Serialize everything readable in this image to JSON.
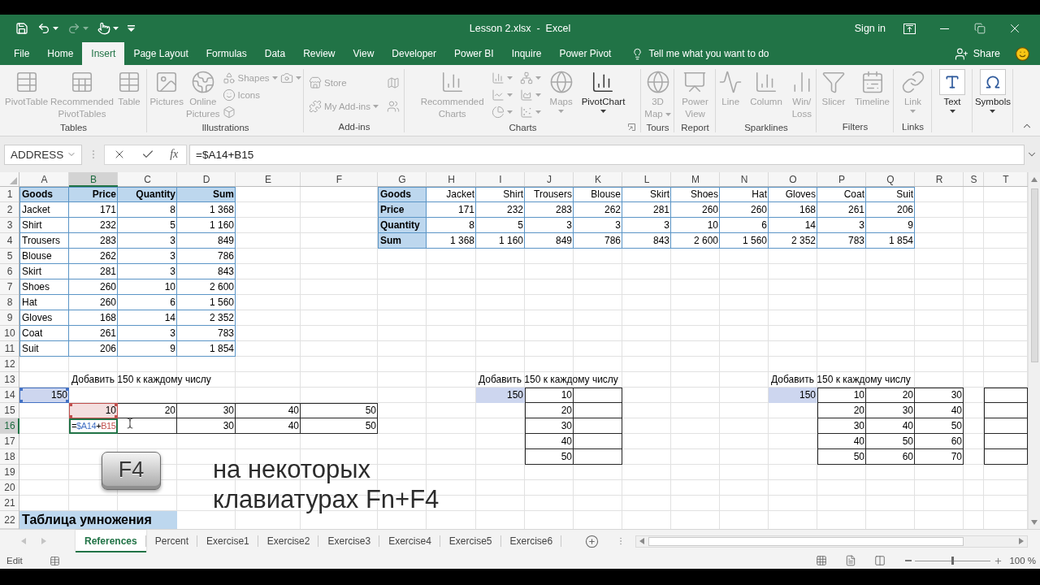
{
  "window": {
    "title": "Lesson 2.xlsx  -  Excel",
    "sign_in": "Sign in"
  },
  "quick_access": [
    {
      "disabled": false
    },
    {
      "disabled": false
    },
    {
      "disabled": true
    },
    {
      "disabled": false
    },
    {
      "disabled": false
    }
  ],
  "ribbon_tabs": [
    {
      "label": "File",
      "selected": false
    },
    {
      "label": "Home",
      "selected": false
    },
    {
      "label": "Insert",
      "selected": true
    },
    {
      "label": "Page Layout",
      "selected": false
    },
    {
      "label": "Formulas",
      "selected": false
    },
    {
      "label": "Data",
      "selected": false
    },
    {
      "label": "Review",
      "selected": false
    },
    {
      "label": "View",
      "selected": false
    },
    {
      "label": "Developer",
      "selected": false
    },
    {
      "label": "Power BI",
      "selected": false
    },
    {
      "label": "Inquire",
      "selected": false
    },
    {
      "label": "Power Pivot",
      "selected": false
    }
  ],
  "tell_me": {
    "placeholder": "Tell me what you want to do"
  },
  "share": "Share",
  "ribbon": {
    "groups": [
      {
        "label": "Tables",
        "items": [
          {
            "kind": "large",
            "label": "PivotTable",
            "disabled": true
          },
          {
            "kind": "large",
            "label": "Recommended\nPivotTables",
            "disabled": true
          },
          {
            "kind": "large",
            "label": "Table",
            "disabled": true
          }
        ]
      },
      {
        "label": "Illustrations",
        "items": [
          {
            "kind": "large",
            "label": "Pictures",
            "disabled": true
          },
          {
            "kind": "large",
            "label": "Online\nPictures",
            "disabled": true
          },
          {
            "kind": "small",
            "label": "Shapes",
            "disabled": true
          },
          {
            "kind": "small",
            "label": "Icons",
            "disabled": true
          },
          {
            "kind": "icon",
            "disabled": true
          },
          {
            "kind": "icon",
            "disabled": true
          }
        ]
      },
      {
        "label": "Add-ins",
        "items": [
          {
            "kind": "small",
            "label": "Store",
            "disabled": true
          },
          {
            "kind": "small",
            "label": "My Add-ins",
            "disabled": true
          },
          {
            "kind": "icon",
            "disabled": true
          },
          {
            "kind": "icon",
            "disabled": true
          }
        ]
      },
      {
        "label": "Charts",
        "items": [
          {
            "kind": "large",
            "label": "Recommended\nCharts",
            "disabled": true
          },
          {
            "kind": "icon",
            "disabled": true
          },
          {
            "kind": "icon",
            "disabled": true
          },
          {
            "kind": "icon",
            "disabled": true
          },
          {
            "kind": "icon",
            "disabled": true
          },
          {
            "kind": "icon",
            "disabled": true
          },
          {
            "kind": "icon",
            "disabled": true
          },
          {
            "kind": "large",
            "label": "Maps",
            "disabled": true
          },
          {
            "kind": "large",
            "label": "PivotChart",
            "disabled": false
          }
        ]
      },
      {
        "label": "Tours",
        "items": [
          {
            "kind": "large",
            "label": "3D\nMap",
            "disabled": true
          }
        ]
      },
      {
        "label": "Report",
        "items": [
          {
            "kind": "large",
            "label": "Power\nView",
            "disabled": true
          }
        ]
      },
      {
        "label": "Sparklines",
        "items": [
          {
            "kind": "large",
            "label": "Line",
            "disabled": true
          },
          {
            "kind": "large",
            "label": "Column",
            "disabled": true
          },
          {
            "kind": "large",
            "label": "Win/\nLoss",
            "disabled": true
          }
        ]
      },
      {
        "label": "Filters",
        "items": [
          {
            "kind": "large",
            "label": "Slicer",
            "disabled": true
          },
          {
            "kind": "large",
            "label": "Timeline",
            "disabled": true
          }
        ]
      },
      {
        "label": "Links",
        "items": [
          {
            "kind": "large",
            "label": "Link",
            "disabled": true
          }
        ]
      },
      {
        "items": [
          {
            "kind": "large",
            "label": "Text",
            "disabled": false
          }
        ]
      },
      {
        "items": [
          {
            "kind": "large",
            "label": "Symbols",
            "disabled": false
          }
        ]
      }
    ]
  },
  "formula_bar": {
    "name_box": "ADDRESS",
    "function_symbol": "fx",
    "formula": "=$A14+B15"
  },
  "sheet": {
    "columns": [
      "A",
      "B",
      "C",
      "D",
      "E",
      "F",
      "G",
      "H",
      "I",
      "J",
      "K",
      "L",
      "M",
      "N",
      "O",
      "P",
      "Q",
      "R",
      "S",
      "T"
    ],
    "rows": [
      {
        "number": "1",
        "cells": [
          {
            "text": "Goods",
            "kind": "key"
          },
          {
            "text": "Price",
            "kind": "heading"
          },
          {
            "text": "Quantity",
            "kind": "heading"
          },
          {
            "text": "Sum",
            "kind": "heading"
          },
          null,
          null,
          {
            "text": "Goods",
            "kind": "key"
          },
          {
            "text": "Jacket",
            "kind": "entry"
          },
          {
            "text": "Shirt",
            "kind": "entry"
          },
          {
            "text": "Trousers",
            "kind": "entry"
          },
          {
            "text": "Blouse",
            "kind": "entry"
          },
          {
            "text": "Skirt",
            "kind": "entry"
          },
          {
            "text": "Shoes",
            "kind": "entry"
          },
          {
            "text": "Hat",
            "kind": "entry"
          },
          {
            "text": "Gloves",
            "kind": "entry"
          },
          {
            "text": "Coat",
            "kind": "entry"
          },
          {
            "text": "Suit",
            "kind": "entry"
          }
        ]
      },
      {
        "number": "2",
        "cells": [
          {
            "text": "Jacket",
            "kind": "label"
          },
          {
            "text": "171",
            "kind": "entry"
          },
          {
            "text": "8",
            "kind": "entry"
          },
          {
            "text": "1 368",
            "kind": "entry"
          },
          null,
          null,
          {
            "text": "Price",
            "kind": "key"
          },
          {
            "text": "171",
            "kind": "entry"
          },
          {
            "text": "232",
            "kind": "entry"
          },
          {
            "text": "283",
            "kind": "entry"
          },
          {
            "text": "262",
            "kind": "entry"
          },
          {
            "text": "281",
            "kind": "entry"
          },
          {
            "text": "260",
            "kind": "entry"
          },
          {
            "text": "260",
            "kind": "entry"
          },
          {
            "text": "168",
            "kind": "entry"
          },
          {
            "text": "261",
            "kind": "entry"
          },
          {
            "text": "206",
            "kind": "entry"
          }
        ]
      },
      {
        "number": "3",
        "cells": [
          {
            "text": "Shirt",
            "kind": "label"
          },
          {
            "text": "232",
            "kind": "entry"
          },
          {
            "text": "5",
            "kind": "entry"
          },
          {
            "text": "1 160",
            "kind": "entry"
          },
          null,
          null,
          {
            "text": "Quantity",
            "kind": "key"
          },
          {
            "text": "8",
            "kind": "entry"
          },
          {
            "text": "5",
            "kind": "entry"
          },
          {
            "text": "3",
            "kind": "entry"
          },
          {
            "text": "3",
            "kind": "entry"
          },
          {
            "text": "3",
            "kind": "entry"
          },
          {
            "text": "10",
            "kind": "entry"
          },
          {
            "text": "6",
            "kind": "entry"
          },
          {
            "text": "14",
            "kind": "entry"
          },
          {
            "text": "3",
            "kind": "entry"
          },
          {
            "text": "9",
            "kind": "entry"
          }
        ]
      },
      {
        "number": "4",
        "cells": [
          {
            "text": "Trousers",
            "kind": "label"
          },
          {
            "text": "283",
            "kind": "entry"
          },
          {
            "text": "3",
            "kind": "entry"
          },
          {
            "text": "849",
            "kind": "entry"
          },
          null,
          null,
          {
            "text": "Sum",
            "kind": "key"
          },
          {
            "text": "1 368",
            "kind": "entry"
          },
          {
            "text": "1 160",
            "kind": "entry"
          },
          {
            "text": "849",
            "kind": "entry"
          },
          {
            "text": "786",
            "kind": "entry"
          },
          {
            "text": "843",
            "kind": "entry"
          },
          {
            "text": "2 600",
            "kind": "entry"
          },
          {
            "text": "1 560",
            "kind": "entry"
          },
          {
            "text": "2 352",
            "kind": "entry"
          },
          {
            "text": "783",
            "kind": "entry"
          },
          {
            "text": "1 854",
            "kind": "entry"
          }
        ]
      },
      {
        "number": "5",
        "cells": [
          {
            "text": "Blouse",
            "kind": "label"
          },
          {
            "text": "262",
            "kind": "entry"
          },
          {
            "text": "3",
            "kind": "entry"
          },
          {
            "text": "786",
            "kind": "entry"
          }
        ]
      },
      {
        "number": "6",
        "cells": [
          {
            "text": "Skirt",
            "kind": "label"
          },
          {
            "text": "281",
            "kind": "entry"
          },
          {
            "text": "3",
            "kind": "entry"
          },
          {
            "text": "843",
            "kind": "entry"
          }
        ]
      },
      {
        "number": "7",
        "cells": [
          {
            "text": "Shoes",
            "kind": "label"
          },
          {
            "text": "260",
            "kind": "entry"
          },
          {
            "text": "10",
            "kind": "entry"
          },
          {
            "text": "2 600",
            "kind": "entry"
          }
        ]
      },
      {
        "number": "8",
        "cells": [
          {
            "text": "Hat",
            "kind": "label"
          },
          {
            "text": "260",
            "kind": "entry"
          },
          {
            "text": "6",
            "kind": "entry"
          },
          {
            "text": "1 560",
            "kind": "entry"
          }
        ]
      },
      {
        "number": "9",
        "cells": [
          {
            "text": "Gloves",
            "kind": "label"
          },
          {
            "text": "168",
            "kind": "entry"
          },
          {
            "text": "14",
            "kind": "entry"
          },
          {
            "text": "2 352",
            "kind": "entry"
          }
        ]
      },
      {
        "number": "10",
        "cells": [
          {
            "text": "Coat",
            "kind": "label"
          },
          {
            "text": "261",
            "kind": "entry"
          },
          {
            "text": "3",
            "kind": "entry"
          },
          {
            "text": "783",
            "kind": "entry"
          }
        ]
      },
      {
        "number": "11",
        "cells": [
          {
            "text": "Suit",
            "kind": "label"
          },
          {
            "text": "206",
            "kind": "entry"
          },
          {
            "text": "9",
            "kind": "entry"
          },
          {
            "text": "1 854",
            "kind": "entry"
          }
        ]
      },
      {
        "number": "12"
      },
      {
        "number": "13",
        "cells": [
          null,
          {
            "text": "Добавить 150 к каждому числу",
            "kind": "note"
          },
          null,
          null,
          null,
          null,
          null,
          null,
          {
            "text": "Добавить 150 к каждому числу",
            "kind": "note"
          },
          null,
          null,
          null,
          null,
          null,
          {
            "text": "Добавить 150 к каждому числу",
            "kind": "note"
          }
        ]
      },
      {
        "number": "14",
        "cells": [
          {
            "text": "150",
            "kind": "input",
            "color": "#4472c4"
          },
          null,
          null,
          null,
          null,
          null,
          null,
          null,
          {
            "text": "150",
            "kind": "input"
          },
          {
            "text": "10",
            "kind": "boxed"
          },
          {
            "kind": "slot"
          },
          null,
          null,
          null,
          {
            "text": "150",
            "kind": "input"
          },
          {
            "text": "10",
            "kind": "boxed"
          },
          {
            "text": "20",
            "kind": "boxed"
          },
          {
            "text": "30",
            "kind": "boxed"
          },
          null,
          {
            "kind": "slot"
          }
        ]
      },
      {
        "number": "15",
        "cells": [
          null,
          {
            "text": "10",
            "kind": "boxed",
            "color": "#c0504d"
          },
          {
            "text": "20",
            "kind": "boxed"
          },
          {
            "text": "30",
            "kind": "boxed"
          },
          {
            "text": "40",
            "kind": "boxed"
          },
          {
            "text": "50",
            "kind": "boxed"
          },
          null,
          null,
          null,
          {
            "text": "20",
            "kind": "boxed"
          },
          {
            "kind": "slot"
          },
          null,
          null,
          null,
          null,
          {
            "text": "20",
            "kind": "boxed"
          },
          {
            "text": "30",
            "kind": "boxed"
          },
          {
            "text": "40",
            "kind": "boxed"
          },
          null,
          {
            "kind": "slot"
          }
        ]
      },
      {
        "number": "16",
        "cells": [
          null,
          {
            "kind": "formula",
            "parts": [
              {
                "text": "="
              },
              {
                "text": "$A14",
                "color": "#4472c4"
              },
              {
                "text": "+"
              },
              {
                "text": "B15",
                "color": "#c0504d"
              }
            ]
          },
          {
            "kind": "slot"
          },
          {
            "text": "30",
            "kind": "boxed"
          },
          {
            "text": "40",
            "kind": "boxed"
          },
          {
            "text": "50",
            "kind": "boxed"
          },
          null,
          null,
          null,
          {
            "text": "30",
            "kind": "boxed"
          },
          {
            "kind": "slot"
          },
          null,
          null,
          null,
          null,
          {
            "text": "30",
            "kind": "boxed"
          },
          {
            "text": "40",
            "kind": "boxed"
          },
          {
            "text": "50",
            "kind": "boxed"
          },
          null,
          {
            "kind": "slot"
          }
        ]
      },
      {
        "number": "17",
        "cells": [
          null,
          null,
          null,
          null,
          null,
          null,
          null,
          null,
          null,
          {
            "text": "40",
            "kind": "boxed"
          },
          {
            "kind": "slot"
          },
          null,
          null,
          null,
          null,
          {
            "text": "40",
            "kind": "boxed"
          },
          {
            "text": "50",
            "kind": "boxed"
          },
          {
            "text": "60",
            "kind": "boxed"
          },
          null,
          {
            "kind": "slot"
          }
        ]
      },
      {
        "number": "18",
        "cells": [
          null,
          null,
          null,
          null,
          null,
          null,
          null,
          null,
          null,
          {
            "text": "50",
            "kind": "boxed"
          },
          {
            "kind": "slot"
          },
          null,
          null,
          null,
          null,
          {
            "text": "50",
            "kind": "boxed"
          },
          {
            "text": "60",
            "kind": "boxed"
          },
          {
            "text": "70",
            "kind": "boxed"
          },
          null,
          {
            "kind": "slot"
          }
        ]
      },
      {
        "number": "19"
      },
      {
        "number": "20"
      },
      {
        "number": "21"
      },
      {
        "number": "22",
        "cells": [
          {
            "text": "Таблица умножения",
            "kind": "title"
          }
        ]
      }
    ]
  },
  "overlay": {
    "key": "F4",
    "caption": "на некоторых\nклавиатурах Fn+F4"
  },
  "sheet_tabs": [
    {
      "label": "References",
      "selected": true
    },
    {
      "label": "Percent",
      "selected": false
    },
    {
      "label": "Exercise1",
      "selected": false
    },
    {
      "label": "Exercise2",
      "selected": false
    },
    {
      "label": "Exercise3",
      "selected": false
    },
    {
      "label": "Exercise4",
      "selected": false
    },
    {
      "label": "Exercise5",
      "selected": false
    },
    {
      "label": "Exercise6",
      "selected": false
    }
  ],
  "status_bar": {
    "mode": "Edit",
    "zoom": {
      "level": 0.5,
      "reading": "100 %"
    }
  }
}
